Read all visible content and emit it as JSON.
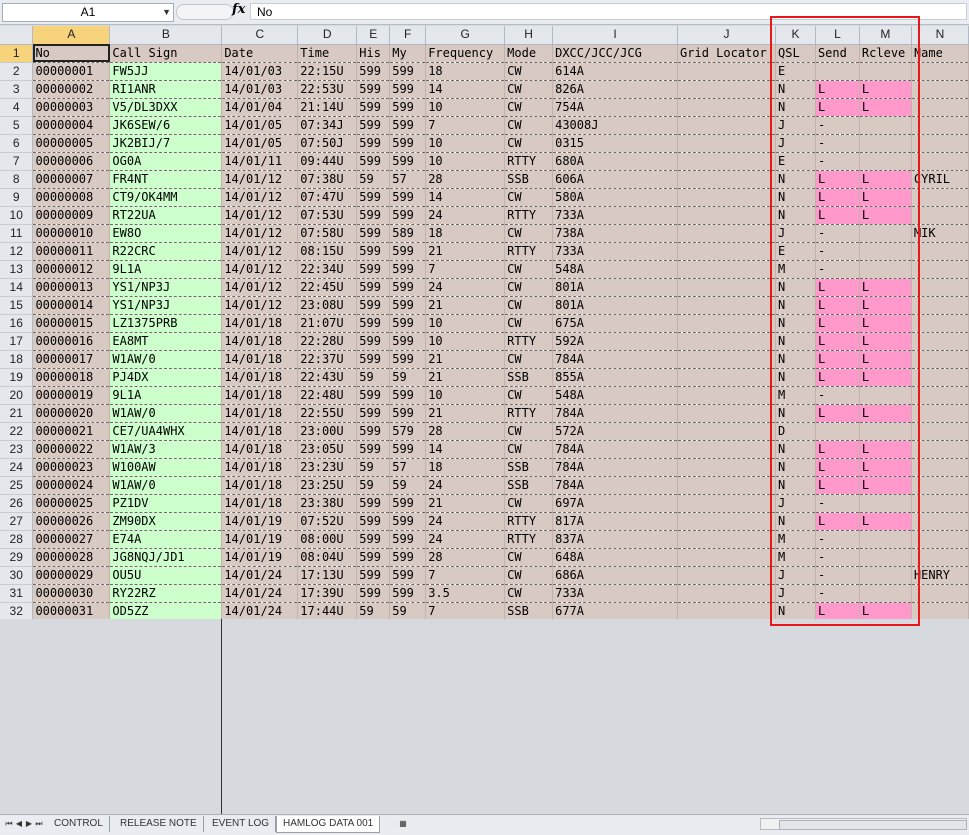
{
  "formula_bar": {
    "name_box": "A1",
    "fx": "fx",
    "value": "No"
  },
  "columns": [
    "A",
    "B",
    "C",
    "D",
    "E",
    "F",
    "G",
    "H",
    "I",
    "J",
    "K",
    "L",
    "M",
    "N"
  ],
  "headers": [
    "No",
    "Call Sign",
    "Date",
    "Time",
    "His",
    "My",
    "Frequency",
    "Mode",
    "DXCC/JCC/JCG",
    "Grid Locator",
    "QSL",
    "Send",
    "Rcleve",
    "Name"
  ],
  "rows": [
    [
      "00000001",
      "FW5JJ",
      "14/01/03",
      "22:15U",
      "599",
      "599",
      "18",
      "CW",
      "614A",
      "",
      "E",
      "",
      "",
      " "
    ],
    [
      "00000002",
      "RI1ANR",
      "14/01/03",
      "22:53U",
      "599",
      "599",
      "14",
      "CW",
      "826A",
      "",
      "N",
      "L",
      "L",
      ""
    ],
    [
      "00000003",
      "V5/DL3DXX",
      "14/01/04",
      "21:14U",
      "599",
      "599",
      "10",
      "CW",
      "754A",
      "",
      "N",
      "L",
      "L",
      ""
    ],
    [
      "00000004",
      "JK6SEW/6",
      "14/01/05",
      "07:34J",
      "599",
      "599",
      "7",
      "CW",
      "43008J",
      "",
      "J",
      "-",
      "",
      ""
    ],
    [
      "00000005",
      "JK2BIJ/7",
      "14/01/05",
      "07:50J",
      "599",
      "599",
      "10",
      "CW",
      "0315",
      "",
      "J",
      "-",
      "",
      ""
    ],
    [
      "00000006",
      "OG0A",
      "14/01/11",
      "09:44U",
      "599",
      "599",
      "10",
      "RTTY",
      "680A",
      "",
      "E",
      "-",
      "",
      ""
    ],
    [
      "00000007",
      "FR4NT",
      "14/01/12",
      "07:38U",
      "59",
      "57",
      "28",
      "SSB",
      "606A",
      "",
      "N",
      "L",
      "L",
      "CYRIL"
    ],
    [
      "00000008",
      "CT9/OK4MM",
      "14/01/12",
      "07:47U",
      "599",
      "599",
      "14",
      "CW",
      "580A",
      "",
      "N",
      "L",
      "L",
      ""
    ],
    [
      "00000009",
      "RT22UA",
      "14/01/12",
      "07:53U",
      "599",
      "599",
      "24",
      "RTTY",
      "733A",
      "",
      "N",
      "L",
      "L",
      ""
    ],
    [
      "00000010",
      "EW8O",
      "14/01/12",
      "07:58U",
      "599",
      "589",
      "18",
      "CW",
      "738A",
      "",
      "J",
      "-",
      "",
      "MIK"
    ],
    [
      "00000011",
      "R22CRC",
      "14/01/12",
      "08:15U",
      "599",
      "599",
      "21",
      "RTTY",
      "733A",
      "",
      "E",
      "-",
      "",
      ""
    ],
    [
      "00000012",
      "9L1A",
      "14/01/12",
      "22:34U",
      "599",
      "599",
      "7",
      "CW",
      "548A",
      "",
      "M",
      "-",
      "",
      ""
    ],
    [
      "00000013",
      "YS1/NP3J",
      "14/01/12",
      "22:45U",
      "599",
      "599",
      "24",
      "CW",
      "801A",
      "",
      "N",
      "L",
      "L",
      ""
    ],
    [
      "00000014",
      "YS1/NP3J",
      "14/01/12",
      "23:08U",
      "599",
      "599",
      "21",
      "CW",
      "801A",
      "",
      "N",
      "L",
      "L",
      ""
    ],
    [
      "00000015",
      "LZ1375PRB",
      "14/01/18",
      "21:07U",
      "599",
      "599",
      "10",
      "CW",
      "675A",
      "",
      "N",
      "L",
      "L",
      ""
    ],
    [
      "00000016",
      "EA8MT",
      "14/01/18",
      "22:28U",
      "599",
      "599",
      "10",
      "RTTY",
      "592A",
      "",
      "N",
      "L",
      "L",
      ""
    ],
    [
      "00000017",
      "W1AW/0",
      "14/01/18",
      "22:37U",
      "599",
      "599",
      "21",
      "CW",
      "784A",
      "",
      "N",
      "L",
      "L",
      ""
    ],
    [
      "00000018",
      "PJ4DX",
      "14/01/18",
      "22:43U",
      "59",
      "59",
      "21",
      "SSB",
      "855A",
      "",
      "N",
      "L",
      "L",
      ""
    ],
    [
      "00000019",
      "9L1A",
      "14/01/18",
      "22:48U",
      "599",
      "599",
      "10",
      "CW",
      "548A",
      "",
      "M",
      "-",
      "",
      ""
    ],
    [
      "00000020",
      "W1AW/0",
      "14/01/18",
      "22:55U",
      "599",
      "599",
      "21",
      "RTTY",
      "784A",
      "",
      "N",
      "L",
      "L",
      ""
    ],
    [
      "00000021",
      "CE7/UA4WHX",
      "14/01/18",
      "23:00U",
      "599",
      "579",
      "28",
      "CW",
      "572A",
      "",
      "D",
      "",
      "",
      ""
    ],
    [
      "00000022",
      "W1AW/3",
      "14/01/18",
      "23:05U",
      "599",
      "599",
      "14",
      "CW",
      "784A",
      "",
      "N",
      "L",
      "L",
      ""
    ],
    [
      "00000023",
      "W100AW",
      "14/01/18",
      "23:23U",
      "59",
      "57",
      "18",
      "SSB",
      "784A",
      "",
      "N",
      "L",
      "L",
      ""
    ],
    [
      "00000024",
      "W1AW/0",
      "14/01/18",
      "23:25U",
      "59",
      "59",
      "24",
      "SSB",
      "784A",
      "",
      "N",
      "L",
      "L",
      ""
    ],
    [
      "00000025",
      "PZ1DV",
      "14/01/18",
      "23:38U",
      "599",
      "599",
      "21",
      "CW",
      "697A",
      "",
      "J",
      "-",
      "",
      ""
    ],
    [
      "00000026",
      "ZM90DX",
      "14/01/19",
      "07:52U",
      "599",
      "599",
      "24",
      "RTTY",
      "817A",
      "",
      "N",
      "L",
      "L",
      ""
    ],
    [
      "00000027",
      "E74A",
      "14/01/19",
      "08:00U",
      "599",
      "599",
      "24",
      "RTTY",
      "837A",
      "",
      "M",
      "-",
      "",
      ""
    ],
    [
      "00000028",
      "JG8NQJ/JD1",
      "14/01/19",
      "08:04U",
      "599",
      "599",
      "28",
      "CW",
      "648A",
      "",
      "M",
      "-",
      "",
      ""
    ],
    [
      "00000029",
      "OU5U",
      "14/01/24",
      "17:13U",
      "599",
      "599",
      "7",
      "CW",
      "686A",
      "",
      "J",
      "-",
      "",
      "HENRY"
    ],
    [
      "00000030",
      "RY22RZ",
      "14/01/24",
      "17:39U",
      "599",
      "599",
      "3.5",
      "CW",
      "733A",
      "",
      "J",
      "-",
      "",
      ""
    ],
    [
      "00000031",
      "OD5ZZ",
      "14/01/24",
      "17:44U",
      "59",
      "59",
      "7",
      "SSB",
      "677A",
      "",
      "N",
      "L",
      "L",
      ""
    ]
  ],
  "tabs": [
    "CONTROL",
    "RELEASE NOTE",
    "EVENT LOG",
    "HAMLOG DATA 001"
  ],
  "active_tab": "HAMLOG DATA 001",
  "colors": {
    "cell_bg": "#d9c9c3",
    "callsign_bg": "#ccffcc",
    "qsl_highlight": "#ff99cc",
    "annotation_box": "#e81818"
  }
}
